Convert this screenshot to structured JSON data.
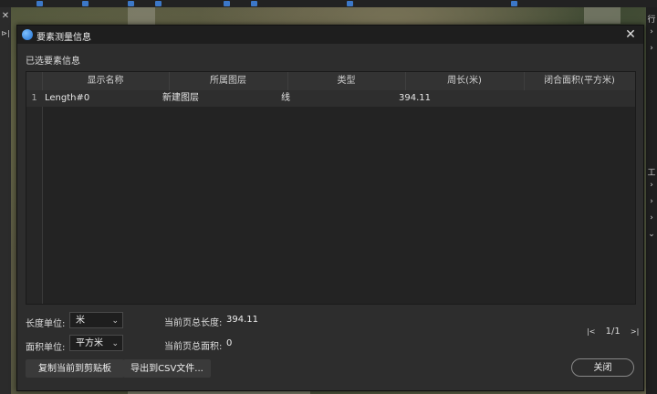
{
  "dialog": {
    "title": "要素测量信息",
    "section_label": "已选要素信息",
    "close_glyph": "✕"
  },
  "table": {
    "columns": [
      "显示名称",
      "所属图层",
      "类型",
      "周长(米)",
      "闭合面积(平方米)"
    ],
    "rows": [
      {
        "index": "1",
        "name": "Length#0",
        "layer": "新建图层",
        "type": "线",
        "perimeter": "394.11",
        "area": ""
      }
    ]
  },
  "length_unit": {
    "label": "长度单位:",
    "value": "米"
  },
  "area_unit": {
    "label": "面积单位:",
    "value": "平方米"
  },
  "totals": {
    "length_label": "当前页总长度:",
    "length_value": "394.11",
    "area_label": "当前页总面积:",
    "area_value": "0"
  },
  "pagination": {
    "first": "|<",
    "page": "1/1",
    "last": ">|"
  },
  "buttons": {
    "copy": "复制当前到剪贴板",
    "export": "导出到CSV文件...",
    "close": "关闭"
  },
  "side_panel": {
    "left_top": "✕",
    "left_arrow": "⊳|",
    "right_top": "行",
    "right_mid": "工"
  }
}
